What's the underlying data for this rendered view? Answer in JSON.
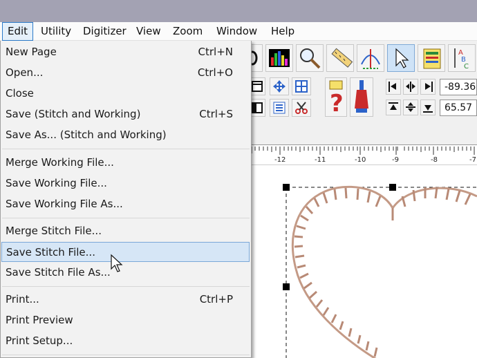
{
  "menubar": {
    "items": [
      "Edit",
      "Utility",
      "Digitizer",
      "View",
      "Zoom",
      "Window",
      "Help"
    ]
  },
  "file_menu": {
    "items": [
      {
        "label": "New Page",
        "shortcut": "Ctrl+N"
      },
      {
        "label": "Open...",
        "shortcut": "Ctrl+O"
      },
      {
        "label": "Close",
        "shortcut": ""
      },
      {
        "label": "Save (Stitch and Working)",
        "shortcut": "Ctrl+S"
      },
      {
        "label": "Save As... (Stitch and Working)",
        "shortcut": ""
      },
      {
        "label": "Merge Working File...",
        "shortcut": ""
      },
      {
        "label": "Save Working File...",
        "shortcut": ""
      },
      {
        "label": "Save Working File As...",
        "shortcut": ""
      },
      {
        "label": "Merge Stitch File...",
        "shortcut": ""
      },
      {
        "label": "Save Stitch File...",
        "shortcut": ""
      },
      {
        "label": "Save Stitch File As...",
        "shortcut": ""
      },
      {
        "label": "Print...",
        "shortcut": "Ctrl+P"
      },
      {
        "label": "Print Preview",
        "shortcut": ""
      },
      {
        "label": "Print Setup...",
        "shortcut": ""
      }
    ],
    "highlighted_item": "Save Stitch File..."
  },
  "coords": {
    "x_value": "-89.36",
    "y_value": "65.57"
  },
  "ruler": {
    "labels": [
      "-12",
      "-11",
      "-10",
      "-9",
      "-8",
      "-7"
    ]
  },
  "colors": {
    "titlebar": "#a3a2b3",
    "menu_highlight": "#d6e6f6",
    "stitch": "#c49a86"
  }
}
